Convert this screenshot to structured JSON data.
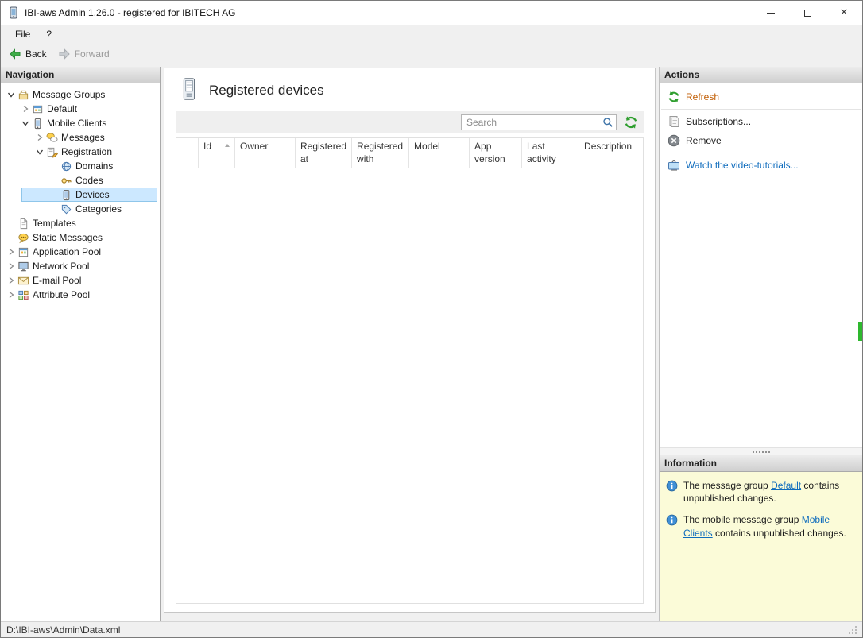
{
  "window": {
    "title": "IBI-aws Admin 1.26.0 - registered for IBITECH AG"
  },
  "menu": {
    "file": "File",
    "help": "?"
  },
  "toolbar": {
    "back_label": "Back",
    "forward_label": "Forward"
  },
  "navigation": {
    "header": "Navigation",
    "tree": [
      {
        "label": "Message Groups",
        "icon": "message-groups-icon",
        "expanded": true
      },
      {
        "label": "Default",
        "icon": "message-group-icon",
        "expanded": false
      },
      {
        "label": "Mobile Clients",
        "icon": "mobile-clients-icon",
        "expanded": true
      },
      {
        "label": "Messages",
        "icon": "messages-icon",
        "expanded": false
      },
      {
        "label": "Registration",
        "icon": "registration-icon",
        "expanded": true
      },
      {
        "label": "Domains",
        "icon": "domains-icon"
      },
      {
        "label": "Codes",
        "icon": "codes-icon"
      },
      {
        "label": "Devices",
        "icon": "devices-icon",
        "selected": true
      },
      {
        "label": "Categories",
        "icon": "categories-icon"
      },
      {
        "label": "Templates",
        "icon": "templates-icon"
      },
      {
        "label": "Static Messages",
        "icon": "static-messages-icon"
      },
      {
        "label": "Application Pool",
        "icon": "application-pool-icon",
        "expanded": false
      },
      {
        "label": "Network Pool",
        "icon": "network-pool-icon",
        "expanded": false
      },
      {
        "label": "E-mail Pool",
        "icon": "email-pool-icon",
        "expanded": false
      },
      {
        "label": "Attribute Pool",
        "icon": "attribute-pool-icon",
        "expanded": false
      }
    ]
  },
  "main": {
    "title": "Registered devices",
    "search_placeholder": "Search",
    "columns": [
      "Id",
      "Owner",
      "Registered at",
      "Registered with",
      "Model",
      "App version",
      "Last activity",
      "Description"
    ],
    "sort_column": "Id",
    "sort_direction": "asc",
    "rows": []
  },
  "actions": {
    "header": "Actions",
    "items": [
      {
        "label": "Refresh",
        "icon": "refresh-icon"
      },
      {
        "label": "Subscriptions...",
        "icon": "subscriptions-icon"
      },
      {
        "label": "Remove",
        "icon": "remove-icon"
      },
      {
        "label": "Watch the video-tutorials...",
        "icon": "tv-icon"
      }
    ]
  },
  "information": {
    "header": "Information",
    "items": [
      {
        "prefix": "The message group ",
        "link": "Default",
        "suffix": " contains unpublished changes."
      },
      {
        "prefix": "The mobile message group ",
        "link": "Mobile Clients",
        "suffix": " contains unpublished changes."
      }
    ]
  },
  "statusbar": {
    "path": "D:\\IBI-aws\\Admin\\Data.xml"
  },
  "colors": {
    "selection": "#cce8ff",
    "link_blue": "#0f6cbd",
    "link_orange": "#c25e04",
    "info_panel_bg": "#fbfbd8",
    "icon_green": "#2e9e2e"
  }
}
